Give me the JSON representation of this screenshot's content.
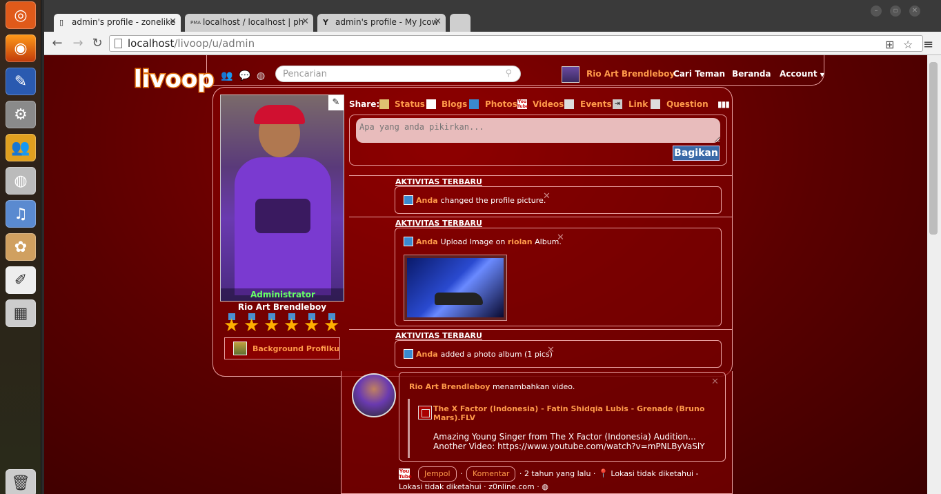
{
  "browser": {
    "tabs": [
      {
        "label": "admin's profile - zonelike",
        "icon": "page-icon"
      },
      {
        "label": "localhost / localhost | ph",
        "icon": "pma-icon"
      },
      {
        "label": "admin's profile - My Jcow",
        "icon": "jcow-icon"
      }
    ],
    "url_host": "localhost",
    "url_path": "/livoop/u/admin"
  },
  "site": {
    "logo_text": "livoop",
    "search_placeholder": "Pencarian",
    "nav": {
      "user_name": "Rio Art Brendleboy",
      "find_friends": "Cari Teman",
      "home": "Beranda",
      "account": "Account"
    }
  },
  "profile": {
    "role_badge": "Administrator",
    "name": "Rio Art Brendleboy",
    "star_count": 6,
    "background_button": "Background Profilku"
  },
  "share": {
    "label": "Share:",
    "items": [
      "Status",
      "Blogs",
      "Photos",
      "Videos",
      "Events",
      "Link",
      "Question"
    ],
    "status_placeholder": "Apa yang anda pikirkan...",
    "submit": "Bagikan"
  },
  "activities": [
    {
      "title": "AKTIVITAS TERBARU",
      "user": "Anda",
      "text": "changed the profile picture."
    },
    {
      "title": "AKTIVITAS TERBARU",
      "user": "Anda",
      "text_before": "Upload Image on",
      "album": "riolan",
      "text_after": "Album."
    },
    {
      "title": "AKTIVITAS TERBARU",
      "user": "Anda",
      "text": "added a photo album (1 pics)"
    }
  ],
  "post": {
    "author": "Rio Art Brendleboy",
    "action": "menambahkan video.",
    "video_title": "The X Factor (Indonesia) - Fatin Shidqia Lubis - Grenade (Bruno Mars).FLV",
    "video_desc": "Amazing Young Singer from The X Factor (Indonesia) Audition... Another Video: https://www.youtube.com/watch?v=mPNLByVaSlY",
    "like": "Jempol",
    "comment": "Komentar",
    "time": "2 tahun yang lalu",
    "location": "Lokasi tidak diketahui - Lokasi tidak diketahui",
    "source": "z0nline.com"
  }
}
